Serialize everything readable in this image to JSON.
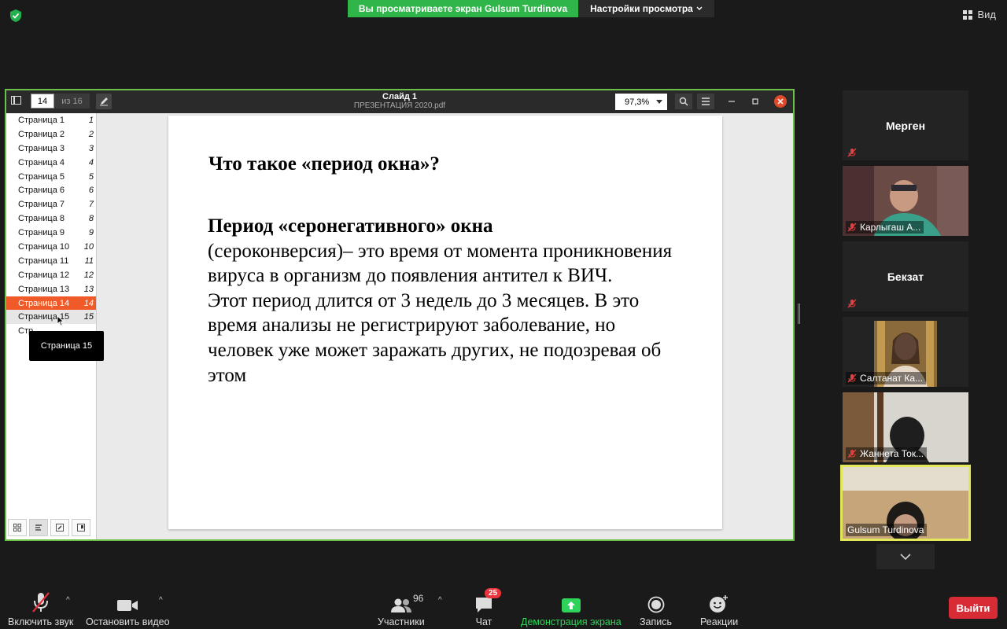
{
  "top": {
    "banner_text": "Вы просматриваете экран Gulsum Turdinova",
    "view_options_label": "Настройки просмотра",
    "view_label": "Вид"
  },
  "viewer": {
    "current_page": "14",
    "of_pages": "из 16",
    "title": "Слайд 1",
    "filename": "ПРЕЗЕНТАЦИЯ 2020.pdf",
    "zoom": "97,3%",
    "pages": [
      {
        "label": "Страница 1",
        "num": "1"
      },
      {
        "label": "Страница 2",
        "num": "2"
      },
      {
        "label": "Страница 3",
        "num": "3"
      },
      {
        "label": "Страница 4",
        "num": "4"
      },
      {
        "label": "Страница 5",
        "num": "5"
      },
      {
        "label": "Страница 6",
        "num": "6"
      },
      {
        "label": "Страница 7",
        "num": "7"
      },
      {
        "label": "Страница 8",
        "num": "8"
      },
      {
        "label": "Страница 9",
        "num": "9"
      },
      {
        "label": "Страница 10",
        "num": "10"
      },
      {
        "label": "Страница 11",
        "num": "11"
      },
      {
        "label": "Страница 12",
        "num": "12"
      },
      {
        "label": "Страница 13",
        "num": "13"
      },
      {
        "label": "Страница 14",
        "num": "14"
      },
      {
        "label": "Страница 15",
        "num": "15"
      },
      {
        "label": "Стр",
        "num": ""
      }
    ],
    "active_page": 13,
    "hover_page": 14,
    "tooltip": "Страница 15"
  },
  "slide": {
    "heading": "Что такое «период окна»?",
    "term": "Период «серонегативного» окна",
    "body": "(сероконверсия)– это время от момента проникновения вируса в организм до появления антител к ВИЧ.",
    "body2": "Этот период длится от 3 недель до 3 месяцев. В это время анализы не регистрируют заболевание, но человек уже может заражать других, не подозревая об этом"
  },
  "participants": [
    {
      "name": "Мерген",
      "has_video": false
    },
    {
      "name": "Карлыгаш А...",
      "has_video": true
    },
    {
      "name": "Бекзат",
      "has_video": false
    },
    {
      "name": "Салтанат Ка...",
      "has_video": true
    },
    {
      "name": "Жаннета Ток...",
      "has_video": true
    },
    {
      "name": "Gulsum Turdinova",
      "has_video": true
    }
  ],
  "toolbar": {
    "unmute": "Включить звук",
    "stop_video": "Остановить видео",
    "participants": "Участники",
    "participants_count": "96",
    "chat": "Чат",
    "chat_badge": "25",
    "share": "Демонстрация экрана",
    "record": "Запись",
    "reactions": "Реакции",
    "leave": "Выйти"
  },
  "colors": {
    "share_green": "#2fb54a",
    "active_page": "#f05a28",
    "leave_red": "#d72b36",
    "speaker_border": "#e3e85a"
  }
}
